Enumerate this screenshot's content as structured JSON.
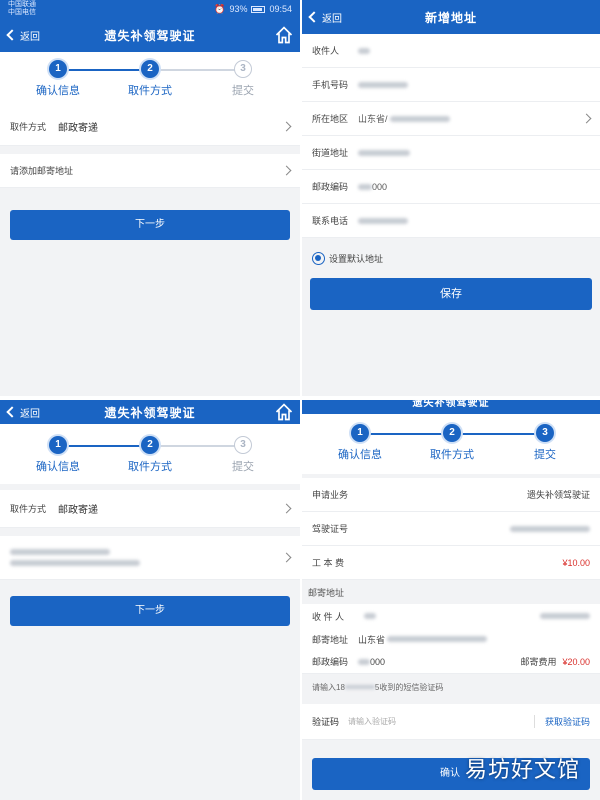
{
  "colors": {
    "primary": "#1a64c3",
    "price": "#d9302c"
  },
  "status": {
    "carrier1": "中国联通",
    "carrier2": "中国电信",
    "battery": "93%",
    "time": "09:54"
  },
  "common": {
    "back": "返回",
    "next_button": "下一步",
    "home_icon": "home-icon"
  },
  "steps": {
    "s1": "确认信息",
    "s2": "取件方式",
    "s3": "提交",
    "n1": "1",
    "n2": "2",
    "n3": "3"
  },
  "panel_tl": {
    "title": "遗失补领驾驶证",
    "pickup_label": "取件方式",
    "pickup_value": "邮政寄递",
    "add_address": "请添加邮寄地址"
  },
  "panel_tr": {
    "title": "新增地址",
    "recipient": "收件人",
    "phone": "手机号码",
    "region": "所在地区",
    "region_value": "山东省/",
    "street": "街道地址",
    "postcode": "邮政编码",
    "postcode_value": "000",
    "contact": "联系电话",
    "default_address": "设置默认地址",
    "save": "保存"
  },
  "panel_bl": {
    "title": "遗失补领驾驶证",
    "pickup_label": "取件方式",
    "pickup_value": "邮政寄递"
  },
  "panel_br": {
    "title": "遗失补领驾驶证",
    "business_label": "申请业务",
    "business_value": "遗失补领驾驶证",
    "license_label": "驾驶证号",
    "fee_label": "工 本 费",
    "fee_value": "¥10.00",
    "mail_section": "邮寄地址",
    "recipient": "收 件 人",
    "mail_address": "邮寄地址",
    "mail_address_value": "山东省",
    "postcode": "邮政编码",
    "postcode_value": "000",
    "postage_label": "邮寄费用",
    "postage_value": "¥20.00",
    "sms_hint_prefix": "请输入18",
    "sms_hint_suffix": "5收到的短信验证码",
    "code_label": "验证码",
    "code_placeholder": "请输入验证码",
    "get_code": "获取验证码",
    "confirm_prefix": "确认"
  },
  "watermark": "易坊好文馆"
}
